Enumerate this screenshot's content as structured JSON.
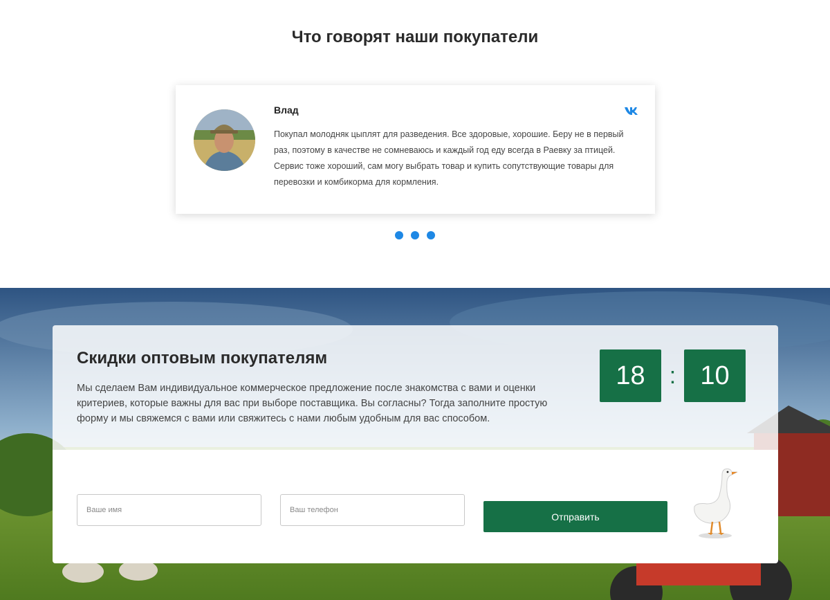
{
  "reviews": {
    "title": "Что говорят наши покупатели",
    "items": [
      {
        "name": "Влад",
        "text": "Покупал молодняк цыплят для разведения. Все здоровые, хорошие. Беру не в первый раз, поэтому в качестве не сомневаюсь и каждый год еду всегда в Раевку за птицей. Сервис тоже хороший, сам могу выбрать товар и купить сопутствующие товары для перевозки и комбикорма для кормления.",
        "social_icon": "vk-icon"
      }
    ],
    "slider_dots": 3,
    "dot_color": "#1e88e5"
  },
  "promo": {
    "title": "Скидки оптовым покупателям",
    "text": "Мы сделаем Вам индивидуальное коммерческое предложение после знакомства с вами и оценки критериев, которые важны для вас при выборе поставщика. Вы согласны? Тогда заполните простую форму и мы свяжемся с вами или свяжитесь с нами любым удобным для вас способом.",
    "timer": {
      "hours": "18",
      "separator": ":",
      "minutes": "10"
    },
    "form": {
      "name_placeholder": "Ваше имя",
      "phone_placeholder": "Ваш телефон",
      "submit_label": "Отправить"
    },
    "accent_color": "#167046"
  }
}
